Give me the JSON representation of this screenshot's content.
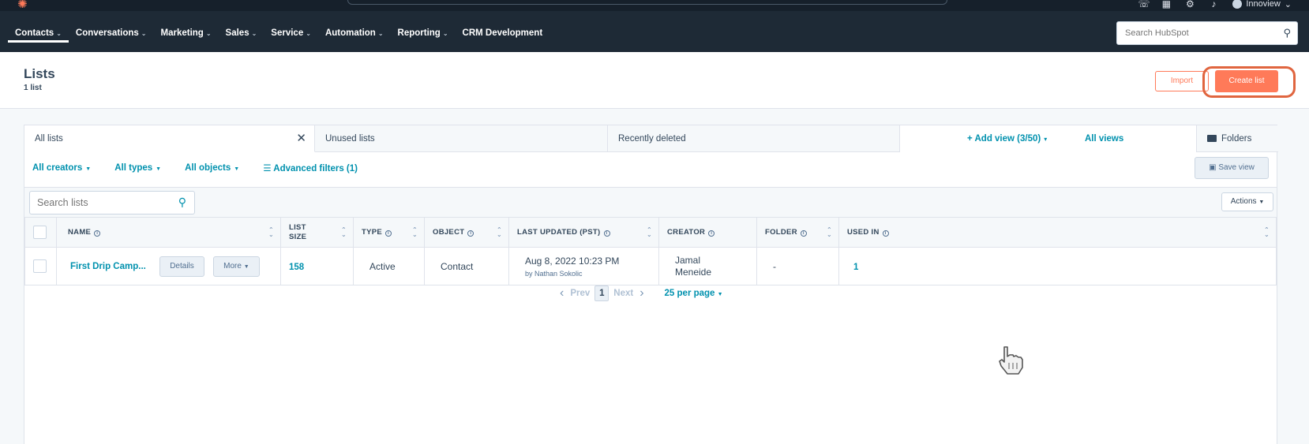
{
  "topbar": {
    "account_name": "Innoview",
    "nav": [
      "Contacts",
      "Conversations",
      "Marketing",
      "Sales",
      "Service",
      "Automation",
      "Reporting",
      "CRM Development"
    ],
    "search_placeholder": "Search HubSpot"
  },
  "header": {
    "title": "Lists",
    "subtitle": "1 list",
    "import_label": "Import",
    "create_label": "Create list"
  },
  "tabs": {
    "all_lists": "All lists",
    "unused_lists": "Unused lists",
    "recently_deleted": "Recently deleted",
    "add_view": "Add view (3/50)",
    "all_views": "All views",
    "folders": "Folders"
  },
  "filters": {
    "creators": "All creators",
    "types": "All types",
    "objects": "All objects",
    "advanced": "Advanced filters (1)",
    "save_view": "Save view"
  },
  "toolbar": {
    "search_placeholder": "Search lists",
    "actions": "Actions"
  },
  "table": {
    "columns": {
      "name": "NAME",
      "list_size_1": "LIST",
      "list_size_2": "SIZE",
      "type": "TYPE",
      "object": "OBJECT",
      "last_updated": "LAST UPDATED (PST)",
      "creator": "CREATOR",
      "folder": "FOLDER",
      "used_in": "USED IN"
    },
    "rows": [
      {
        "name": "First Drip Camp...",
        "details": "Details",
        "more": "More",
        "size": "158",
        "type": "Active",
        "object": "Contact",
        "updated": "Aug 8, 2022 10:23 PM",
        "updated_by": "by Nathan Sokolic",
        "creator_1": "Jamal",
        "creator_2": "Meneide",
        "folder": "-",
        "used_in": "1"
      }
    ]
  },
  "pager": {
    "prev": "Prev",
    "page": "1",
    "next": "Next",
    "per_page": "25 per page"
  },
  "colors": {
    "accent": "#ff7a59",
    "link": "#0091ae",
    "nav_bg": "#1e2a36"
  }
}
